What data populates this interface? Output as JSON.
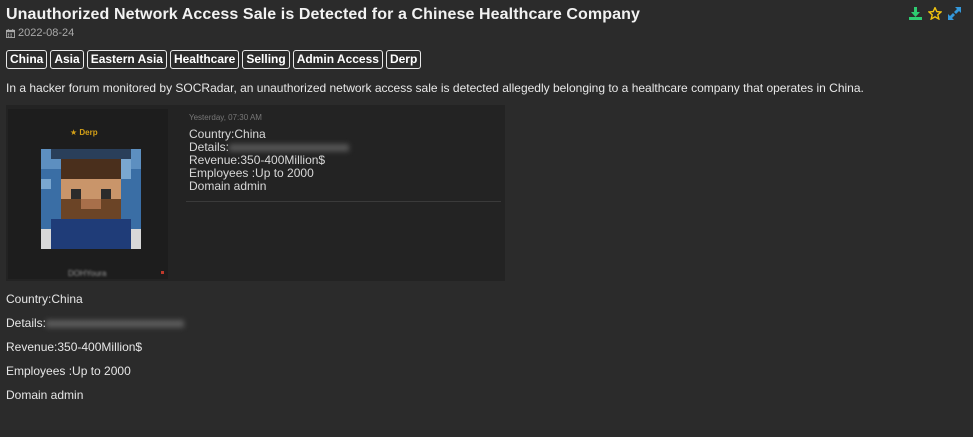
{
  "header": {
    "title": "Unauthorized Network Access Sale is Detected for a Chinese Healthcare Company",
    "date": "2022-08-24"
  },
  "actions": [
    {
      "icon": "download-icon",
      "color": "#2ecc71"
    },
    {
      "icon": "star-icon",
      "color": "#f1c40f"
    },
    {
      "icon": "expand-icon",
      "color": "#3498db"
    }
  ],
  "tags": [
    "China",
    "Asia",
    "Eastern Asia",
    "Healthcare",
    "Selling",
    "Admin Access",
    "Derp"
  ],
  "description": "In a hacker forum monitored by SOCRadar, an unauthorized network access sale is detected allegedly belonging to a healthcare company that operates in China.",
  "screenshot": {
    "rank": "★ Derp",
    "username": "DOHYoura",
    "timestamp": "Yesterday, 07:30 AM",
    "lines": [
      "Country:China",
      "Details:",
      "Revenue:350-400Million$",
      "Employees :Up to 2000",
      "Domain admin"
    ],
    "redacted": "xxxxxxxxxxxxxxxxxxxx"
  },
  "details": {
    "country": "Country:China",
    "details": "Details:",
    "redacted": "xxxxxxxxxxxxxxxxxxxxxxx",
    "revenue": "Revenue:350-400Million$",
    "employees": "Employees :Up to 2000",
    "domain": "Domain admin"
  }
}
